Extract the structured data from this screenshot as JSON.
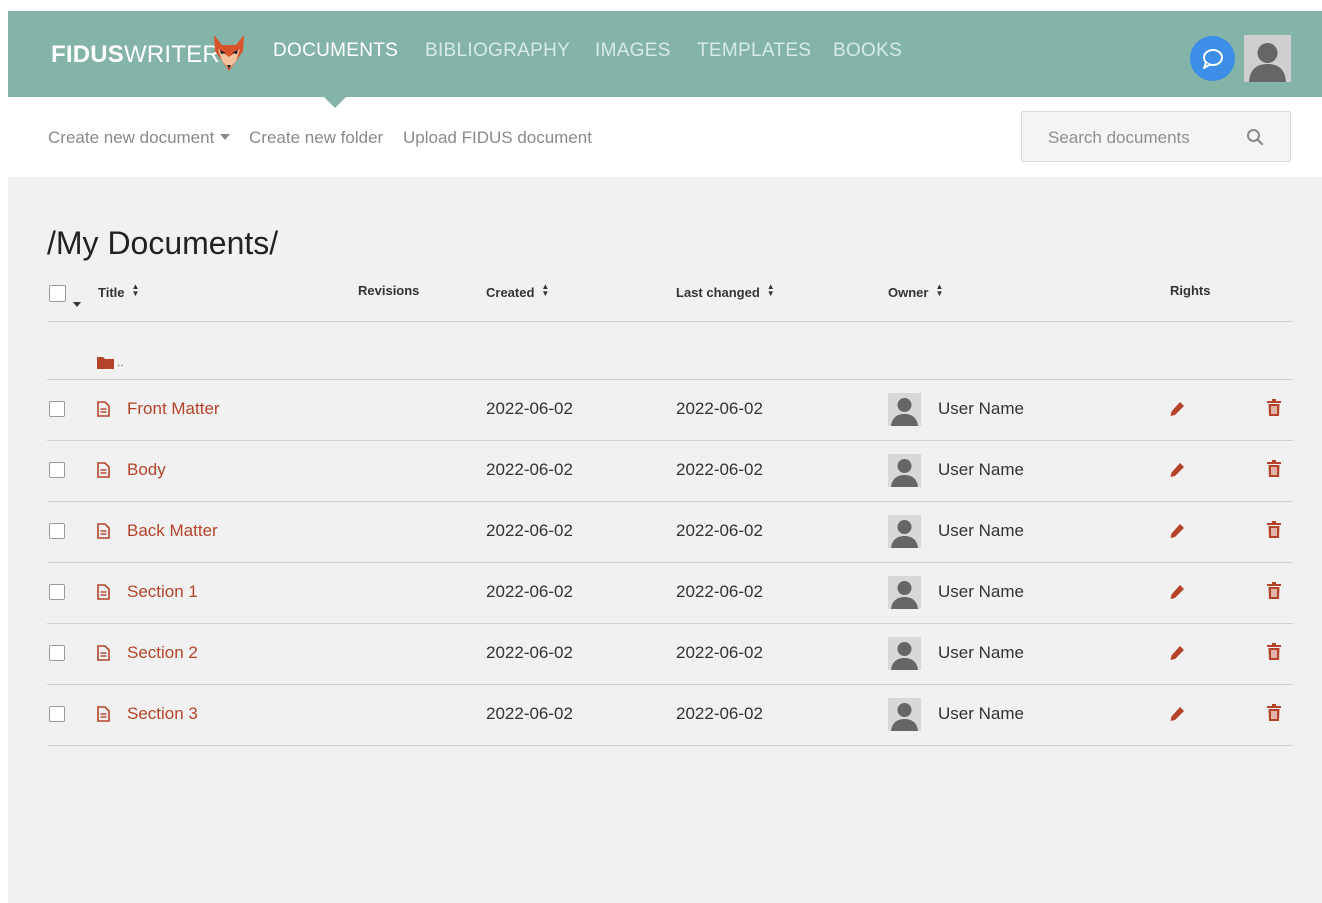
{
  "header": {
    "logo_bold": "FIDUS",
    "logo_light": "WRITER",
    "nav": [
      "DOCUMENTS",
      "BIBLIOGRAPHY",
      "IMAGES",
      "TEMPLATES",
      "BOOKS"
    ],
    "active_nav": "DOCUMENTS",
    "accent_color": "#84b4a8"
  },
  "toolbar": {
    "create_document": "Create new document",
    "create_folder": "Create new folder",
    "upload": "Upload FIDUS document",
    "search_placeholder": "Search documents"
  },
  "main": {
    "page_title": "/My Documents/",
    "columns": {
      "title": "Title",
      "revisions": "Revisions",
      "created": "Created",
      "last_changed": "Last changed",
      "owner": "Owner",
      "rights": "Rights"
    },
    "parent_folder": "..",
    "documents": [
      {
        "title": "Front Matter",
        "created": "2022-06-02",
        "last_changed": "2022-06-02",
        "owner": "User Name"
      },
      {
        "title": "Body",
        "created": "2022-06-02",
        "last_changed": "2022-06-02",
        "owner": "User Name"
      },
      {
        "title": "Back Matter",
        "created": "2022-06-02",
        "last_changed": "2022-06-02",
        "owner": "User Name"
      },
      {
        "title": "Section 1",
        "created": "2022-06-02",
        "last_changed": "2022-06-02",
        "owner": "User Name"
      },
      {
        "title": "Section 2",
        "created": "2022-06-02",
        "last_changed": "2022-06-02",
        "owner": "User Name"
      },
      {
        "title": "Section 3",
        "created": "2022-06-02",
        "last_changed": "2022-06-02",
        "owner": "User Name"
      }
    ],
    "link_color": "#b5432a"
  }
}
